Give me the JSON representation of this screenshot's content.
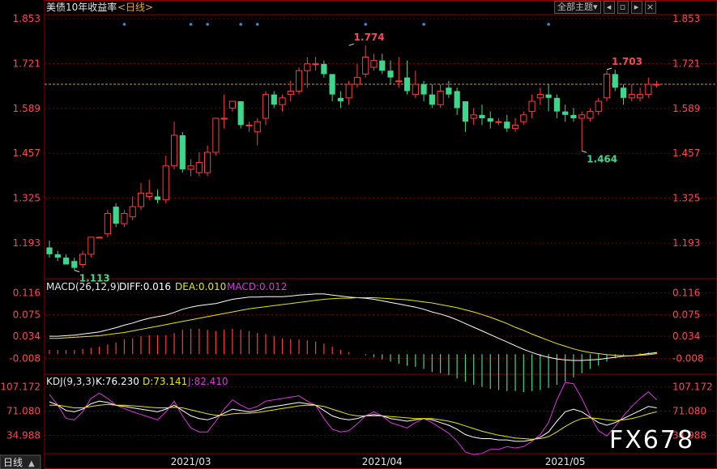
{
  "header": {
    "title": "美债10年收益率",
    "period": "<日线>",
    "menu_label": "全部主题",
    "dropdown_icon": "chevron-down-icon",
    "window_buttons": [
      "prev-icon",
      "restore-icon",
      "next-icon",
      "close-icon"
    ]
  },
  "colors": {
    "up": "#ff3b3b",
    "down": "#3dd68c",
    "price_label": "#ff4455",
    "grid": "#8b0000",
    "diff": "#ffffff",
    "dea": "#e8e800",
    "macd": "#dd33dd",
    "ref_line": "#c89232"
  },
  "chart_data": [
    {
      "type": "candlestick",
      "name": "price",
      "yticks": [
        1.853,
        1.721,
        1.589,
        1.457,
        1.325,
        1.193
      ],
      "ylim": [
        1.093,
        1.865
      ],
      "reference_line": 1.66,
      "annotations": [
        {
          "label": "1.774",
          "value": 1.774,
          "index": 36,
          "kind": "high"
        },
        {
          "label": "1.113",
          "value": 1.113,
          "index": 3,
          "kind": "low"
        },
        {
          "label": "1.464",
          "value": 1.464,
          "index": 64,
          "kind": "low"
        },
        {
          "label": "1.703",
          "value": 1.703,
          "index": 67,
          "kind": "high"
        }
      ],
      "xticks": [
        {
          "label": "2021/03",
          "index": 17
        },
        {
          "label": "2021/04",
          "index": 40
        },
        {
          "label": "2021/05",
          "index": 62
        }
      ],
      "candles": [
        [
          1.18,
          1.16,
          1.2,
          1.15
        ],
        [
          1.16,
          1.15,
          1.17,
          1.14
        ],
        [
          1.15,
          1.13,
          1.16,
          1.13
        ],
        [
          1.14,
          1.12,
          1.15,
          1.113
        ],
        [
          1.13,
          1.16,
          1.17,
          1.12
        ],
        [
          1.16,
          1.21,
          1.21,
          1.15
        ],
        [
          1.21,
          1.21,
          1.21,
          1.21
        ],
        [
          1.22,
          1.28,
          1.29,
          1.21
        ],
        [
          1.3,
          1.25,
          1.31,
          1.24
        ],
        [
          1.25,
          1.28,
          1.29,
          1.24
        ],
        [
          1.27,
          1.3,
          1.33,
          1.26
        ],
        [
          1.3,
          1.34,
          1.37,
          1.29
        ],
        [
          1.33,
          1.34,
          1.38,
          1.32
        ],
        [
          1.33,
          1.32,
          1.35,
          1.31
        ],
        [
          1.32,
          1.42,
          1.45,
          1.31
        ],
        [
          1.42,
          1.51,
          1.55,
          1.41
        ],
        [
          1.51,
          1.41,
          1.52,
          1.4
        ],
        [
          1.41,
          1.42,
          1.44,
          1.39
        ],
        [
          1.4,
          1.43,
          1.46,
          1.39
        ],
        [
          1.4,
          1.46,
          1.48,
          1.39
        ],
        [
          1.46,
          1.56,
          1.56,
          1.45
        ],
        [
          1.56,
          1.56,
          1.63,
          1.53
        ],
        [
          1.59,
          1.61,
          1.61,
          1.58
        ],
        [
          1.61,
          1.54,
          1.61,
          1.53
        ],
        [
          1.54,
          1.54,
          1.55,
          1.52
        ],
        [
          1.52,
          1.55,
          1.56,
          1.48
        ],
        [
          1.56,
          1.63,
          1.64,
          1.54
        ],
        [
          1.63,
          1.6,
          1.64,
          1.59
        ],
        [
          1.6,
          1.62,
          1.63,
          1.58
        ],
        [
          1.63,
          1.64,
          1.67,
          1.61
        ],
        [
          1.64,
          1.7,
          1.71,
          1.63
        ],
        [
          1.7,
          1.72,
          1.74,
          1.65
        ],
        [
          1.72,
          1.72,
          1.74,
          1.7
        ],
        [
          1.72,
          1.69,
          1.73,
          1.68
        ],
        [
          1.69,
          1.63,
          1.69,
          1.61
        ],
        [
          1.62,
          1.61,
          1.64,
          1.59
        ],
        [
          1.62,
          1.66,
          1.67,
          1.6
        ],
        [
          1.66,
          1.68,
          1.72,
          1.65
        ],
        [
          1.69,
          1.74,
          1.774,
          1.68
        ],
        [
          1.71,
          1.73,
          1.75,
          1.7
        ],
        [
          1.73,
          1.7,
          1.75,
          1.69
        ],
        [
          1.7,
          1.68,
          1.73,
          1.66
        ],
        [
          1.67,
          1.67,
          1.74,
          1.65
        ],
        [
          1.68,
          1.64,
          1.73,
          1.63
        ],
        [
          1.63,
          1.66,
          1.7,
          1.62
        ],
        [
          1.66,
          1.63,
          1.67,
          1.61
        ],
        [
          1.63,
          1.6,
          1.66,
          1.59
        ],
        [
          1.6,
          1.64,
          1.66,
          1.59
        ],
        [
          1.65,
          1.63,
          1.67,
          1.62
        ],
        [
          1.64,
          1.59,
          1.65,
          1.57
        ],
        [
          1.61,
          1.55,
          1.61,
          1.52
        ],
        [
          1.56,
          1.57,
          1.59,
          1.54
        ],
        [
          1.57,
          1.56,
          1.6,
          1.54
        ],
        [
          1.56,
          1.55,
          1.58,
          1.53
        ],
        [
          1.55,
          1.55,
          1.56,
          1.54
        ],
        [
          1.55,
          1.53,
          1.57,
          1.52
        ],
        [
          1.53,
          1.54,
          1.56,
          1.52
        ],
        [
          1.55,
          1.57,
          1.58,
          1.54
        ],
        [
          1.58,
          1.61,
          1.63,
          1.56
        ],
        [
          1.62,
          1.63,
          1.65,
          1.6
        ],
        [
          1.63,
          1.62,
          1.66,
          1.58
        ],
        [
          1.62,
          1.58,
          1.63,
          1.56
        ],
        [
          1.58,
          1.57,
          1.6,
          1.55
        ],
        [
          1.57,
          1.56,
          1.59,
          1.55
        ],
        [
          1.56,
          1.57,
          1.58,
          1.464
        ],
        [
          1.56,
          1.58,
          1.59,
          1.55
        ],
        [
          1.58,
          1.61,
          1.62,
          1.57
        ],
        [
          1.62,
          1.69,
          1.7,
          1.61
        ],
        [
          1.69,
          1.65,
          1.703,
          1.64
        ],
        [
          1.65,
          1.62,
          1.66,
          1.6
        ],
        [
          1.62,
          1.63,
          1.66,
          1.61
        ],
        [
          1.62,
          1.63,
          1.65,
          1.61
        ],
        [
          1.63,
          1.66,
          1.68,
          1.62
        ],
        [
          1.66,
          1.66,
          1.67,
          1.65
        ]
      ],
      "dots": [
        9,
        17,
        19,
        23,
        25,
        38,
        45,
        60
      ]
    },
    {
      "type": "macd",
      "name": "MACD",
      "label": "MACD(26,12,9)",
      "diff_label": "DIFF:0.016",
      "dea_label": "DEA:0.010",
      "macd_label": "MACD:0.012",
      "yticks": [
        0.116,
        0.075,
        0.034,
        -0.008
      ],
      "ylim": [
        -0.035,
        0.14
      ],
      "diff": [
        0.034,
        0.034,
        0.035,
        0.036,
        0.038,
        0.04,
        0.042,
        0.046,
        0.05,
        0.055,
        0.059,
        0.064,
        0.068,
        0.071,
        0.074,
        0.079,
        0.085,
        0.089,
        0.092,
        0.094,
        0.096,
        0.1,
        0.104,
        0.106,
        0.108,
        0.108,
        0.109,
        0.109,
        0.109,
        0.11,
        0.112,
        0.113,
        0.114,
        0.114,
        0.112,
        0.11,
        0.108,
        0.107,
        0.106,
        0.104,
        0.101,
        0.098,
        0.095,
        0.092,
        0.089,
        0.085,
        0.08,
        0.076,
        0.071,
        0.065,
        0.058,
        0.051,
        0.044,
        0.037,
        0.03,
        0.023,
        0.016,
        0.009,
        0.003,
        -0.002,
        -0.006,
        -0.009,
        -0.011,
        -0.012,
        -0.012,
        -0.011,
        -0.01,
        -0.008,
        -0.006,
        -0.004,
        -0.003,
        -0.001,
        0.001,
        0.003
      ],
      "dea": [
        0.03,
        0.03,
        0.031,
        0.032,
        0.033,
        0.034,
        0.035,
        0.037,
        0.039,
        0.041,
        0.044,
        0.047,
        0.05,
        0.053,
        0.056,
        0.059,
        0.062,
        0.065,
        0.068,
        0.071,
        0.074,
        0.077,
        0.08,
        0.083,
        0.086,
        0.088,
        0.09,
        0.092,
        0.094,
        0.096,
        0.098,
        0.1,
        0.102,
        0.104,
        0.105,
        0.106,
        0.106,
        0.107,
        0.107,
        0.107,
        0.106,
        0.105,
        0.104,
        0.103,
        0.101,
        0.099,
        0.097,
        0.094,
        0.091,
        0.088,
        0.084,
        0.08,
        0.075,
        0.07,
        0.064,
        0.058,
        0.051,
        0.045,
        0.038,
        0.032,
        0.026,
        0.02,
        0.015,
        0.01,
        0.006,
        0.003,
        0.001,
        -0.001,
        -0.002,
        -0.003,
        -0.003,
        -0.002,
        -0.001,
        0.001
      ],
      "hist": [
        0.008,
        0.008,
        0.008,
        0.008,
        0.01,
        0.012,
        0.014,
        0.018,
        0.022,
        0.028,
        0.03,
        0.034,
        0.036,
        0.036,
        0.036,
        0.04,
        0.046,
        0.048,
        0.048,
        0.046,
        0.044,
        0.046,
        0.048,
        0.046,
        0.044,
        0.04,
        0.038,
        0.034,
        0.03,
        0.028,
        0.028,
        0.026,
        0.024,
        0.02,
        0.014,
        0.008,
        0.004,
        0.0,
        -0.002,
        -0.006,
        -0.01,
        -0.014,
        -0.018,
        -0.022,
        -0.024,
        -0.028,
        -0.034,
        -0.036,
        -0.04,
        -0.046,
        -0.052,
        -0.058,
        -0.062,
        -0.066,
        -0.068,
        -0.07,
        -0.07,
        -0.072,
        -0.07,
        -0.068,
        -0.064,
        -0.058,
        -0.052,
        -0.044,
        -0.036,
        -0.028,
        -0.022,
        -0.014,
        -0.008,
        -0.002,
        0.0,
        0.002,
        0.004,
        0.004
      ]
    },
    {
      "type": "kdj",
      "name": "KDJ",
      "label": "KDJ(9,3,3)",
      "k_label": "K:76.230",
      "d_label": "D:73.141",
      "j_label": "J:82.410",
      "yticks": [
        107.172,
        71.08,
        34.988
      ],
      "ylim": [
        10,
        125
      ],
      "k": [
        85,
        80,
        72,
        70,
        74,
        82,
        86,
        84,
        80,
        78,
        76,
        74,
        72,
        70,
        74,
        80,
        72,
        64,
        60,
        58,
        62,
        68,
        74,
        72,
        70,
        72,
        76,
        78,
        80,
        82,
        84,
        82,
        80,
        72,
        64,
        60,
        58,
        60,
        64,
        66,
        64,
        60,
        58,
        56,
        58,
        60,
        58,
        54,
        50,
        44,
        36,
        32,
        30,
        30,
        28,
        28,
        26,
        26,
        28,
        32,
        40,
        56,
        70,
        74,
        70,
        62,
        54,
        50,
        54,
        60,
        66,
        72,
        78,
        76
      ],
      "d": [
        80,
        80,
        78,
        76,
        76,
        78,
        80,
        81,
        80,
        80,
        79,
        78,
        77,
        76,
        76,
        77,
        76,
        73,
        70,
        67,
        65,
        65,
        67,
        68,
        68,
        69,
        71,
        73,
        75,
        77,
        79,
        80,
        80,
        78,
        74,
        70,
        66,
        64,
        64,
        64,
        64,
        63,
        62,
        61,
        60,
        60,
        60,
        58,
        56,
        53,
        49,
        45,
        41,
        38,
        35,
        33,
        31,
        30,
        29,
        30,
        33,
        40,
        48,
        55,
        60,
        61,
        60,
        58,
        57,
        58,
        60,
        63,
        67,
        70
      ],
      "j": [
        96,
        80,
        60,
        58,
        70,
        90,
        98,
        90,
        80,
        75,
        70,
        66,
        62,
        58,
        70,
        86,
        64,
        46,
        40,
        40,
        56,
        74,
        88,
        80,
        74,
        78,
        86,
        88,
        90,
        92,
        94,
        86,
        80,
        60,
        44,
        40,
        42,
        52,
        64,
        70,
        64,
        54,
        50,
        46,
        54,
        60,
        54,
        46,
        38,
        26,
        10,
        6,
        8,
        14,
        14,
        18,
        16,
        18,
        26,
        36,
        54,
        88,
        114,
        112,
        90,
        64,
        42,
        34,
        48,
        64,
        78,
        90,
        100,
        88
      ]
    }
  ],
  "watermark": "FX678"
}
